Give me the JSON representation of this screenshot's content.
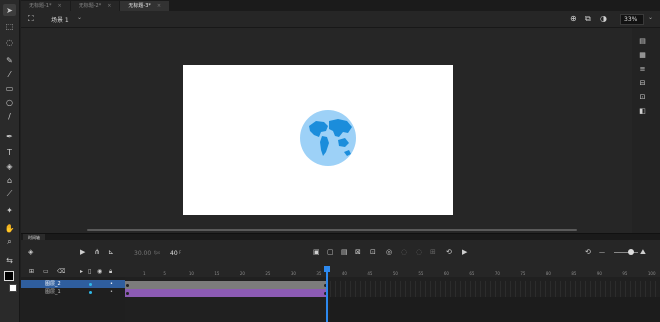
{
  "tabs": [
    {
      "label": "无标题-1*",
      "active": false
    },
    {
      "label": "无标题-2*",
      "active": false
    },
    {
      "label": "无标题-3*",
      "active": true
    }
  ],
  "tab_close": "×",
  "scene": {
    "label": "场景 1",
    "caret": "⌄"
  },
  "zoom": {
    "value": "33%",
    "caret": "⌄"
  },
  "timeline": {
    "tab_label": "时间轴",
    "fps": "30.00",
    "fps_unit": "fps",
    "current_frame": "40",
    "frame_unit": "F",
    "ruler": [
      "1",
      "5",
      "10",
      "15",
      "20",
      "25",
      "30",
      "35",
      "40",
      "45",
      "50",
      "55",
      "60",
      "65",
      "70",
      "75",
      "80",
      "85",
      "90",
      "95",
      "100"
    ],
    "layers": [
      {
        "name": "图层_2",
        "selected": true,
        "color": "#2fb8e8"
      },
      {
        "name": "图层_1",
        "selected": false,
        "color": "#2fb8e8"
      }
    ]
  },
  "colors": {
    "accent": "#2d89ef",
    "tween": "#8c5bb4",
    "globe_water": "#9dd1f7",
    "globe_land": "#1b8ddb"
  }
}
